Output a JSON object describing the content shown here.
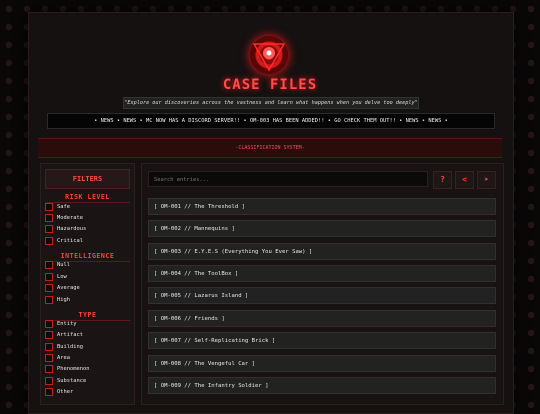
{
  "header": {
    "title": "CASE FILES",
    "subtitle": "\"Explore our discoveries across the vastness and learn what happens when you delve too deeply\"",
    "ticker": "• NEWS • NEWS • MC NOW HAS A DISCORD SERVER!! • OM-003 HAS BEEN ADDED!! • GO CHECK THEM OUT!! • NEWS • NEWS •",
    "classification": "-CLASSIFICATION SYSTEM-"
  },
  "filters": {
    "button_label": "FILTERS",
    "groups": [
      {
        "title": "RISK LEVEL",
        "options": [
          "Safe",
          "Moderate",
          "Hazardous",
          "Critical"
        ]
      },
      {
        "title": "INTELLIGENCE",
        "options": [
          "Null",
          "Low",
          "Average",
          "High"
        ]
      },
      {
        "title": "TYPE",
        "options": [
          "Entity",
          "Artifact",
          "Building",
          "Area",
          "Phenomenon",
          "Substance",
          "Other"
        ]
      }
    ]
  },
  "search": {
    "placeholder": "Search entries...",
    "help_label": "?",
    "prev_label": "<",
    "next_label": "➤"
  },
  "entries": [
    "[ OM-001 // The Threshold ]",
    "[ OM-002 // Mannequins ]",
    "[ OM-003 // E.Y.E.S (Everything You Ever Saw) ]",
    "[ OM-004 // The ToolBox ]",
    "[ OM-005 // Lazarus Island ]",
    "[ OM-006 // Friends ]",
    "[ OM-007 // Self-Replicating Brick ]",
    "[ OM-008 // The Vengeful Car ]",
    "[ OM-009 // The Infantry Soldier ]"
  ],
  "colors": {
    "accent": "#ff3d3d",
    "background": "#0a0707",
    "panel": "#181212"
  }
}
